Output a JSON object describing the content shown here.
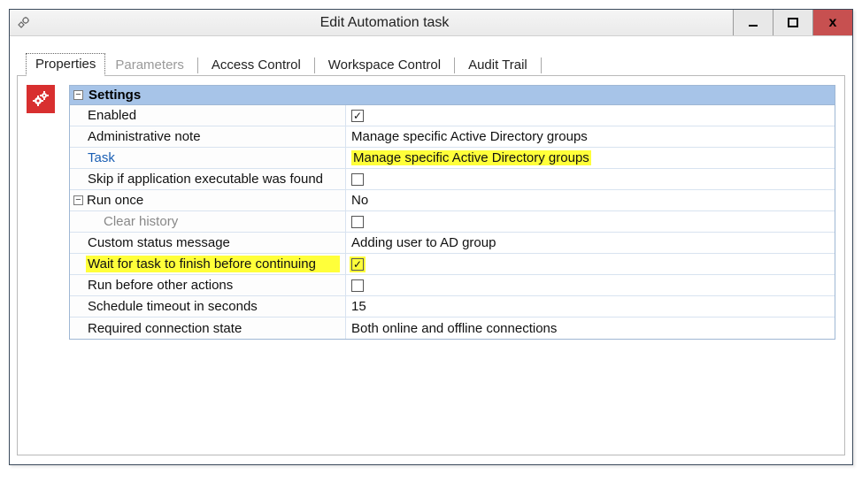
{
  "window": {
    "title": "Edit Automation task"
  },
  "tabs": {
    "properties": "Properties",
    "parameters": "Parameters",
    "access": "Access Control",
    "workspace": "Workspace Control",
    "audit": "Audit Trail"
  },
  "grid": {
    "section": "Settings",
    "rows": {
      "enabled": {
        "label": "Enabled",
        "checked": true
      },
      "note": {
        "label": "Administrative note",
        "value": "Manage specific Active Directory groups"
      },
      "task": {
        "label": "Task",
        "value": "Manage specific Active Directory groups"
      },
      "skip": {
        "label": "Skip if application executable was found",
        "checked": false
      },
      "runonce": {
        "label": "Run once",
        "value": "No"
      },
      "clear": {
        "label": "Clear history",
        "checked": false
      },
      "status": {
        "label": "Custom status message",
        "value": "Adding user to AD group"
      },
      "wait": {
        "label": "Wait for task to finish before continuing",
        "checked": true
      },
      "before": {
        "label": "Run before other actions",
        "checked": false
      },
      "timeout": {
        "label": "Schedule timeout in seconds",
        "value": "15"
      },
      "conn": {
        "label": "Required connection state",
        "value": "Both online and offline connections"
      }
    }
  },
  "glyphs": {
    "minus": "−",
    "check": "✓"
  }
}
